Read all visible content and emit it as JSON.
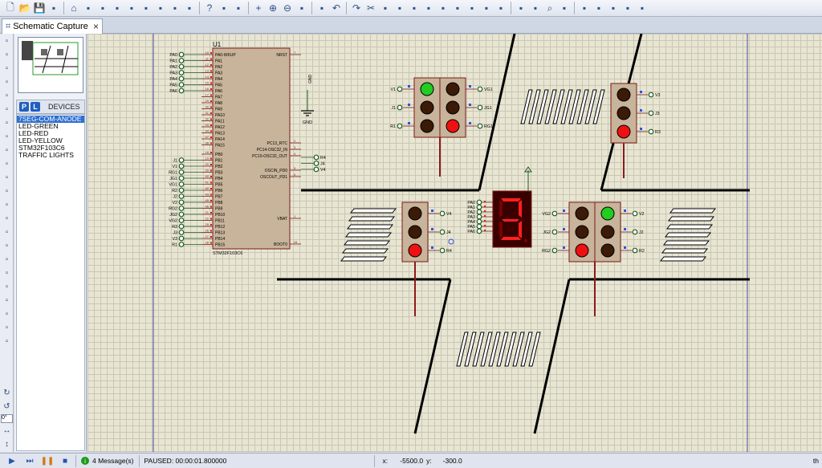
{
  "toolbar": {
    "icons": [
      "new-file-icon",
      "open-folder-icon",
      "save-icon",
      "import-icon",
      "home-icon",
      "grid-icon",
      "origin-icon",
      "pin-icon",
      "back-icon",
      "component-icon",
      "pdf-icon",
      "page-icon",
      "layout-icon",
      "help-icon",
      "refresh-icon",
      "grid-toggle-icon",
      "cross-icon",
      "zoom-in-icon",
      "zoom-out-icon",
      "zoom-fit-icon",
      "zoom-area-icon",
      "undo-icon",
      "redo-icon",
      "cut-icon",
      "copy-icon",
      "paste-icon",
      "block-copy-icon",
      "block-move-icon",
      "block-rotate-icon",
      "block-delete-icon",
      "pick-icon",
      "make-device-icon",
      "package-icon",
      "decompose-icon",
      "wire-autorouter-icon",
      "search-icon",
      "property-tool-icon",
      "new-sheet-icon",
      "remove-sheet-icon",
      "netlist-icon",
      "bom-icon",
      "erc-icon"
    ]
  },
  "tab": {
    "label": "Schematic Capture",
    "close": "×"
  },
  "devices": {
    "p": "P",
    "l": "L",
    "header": "DEVICES",
    "items": [
      "7SEG-COM-ANODE",
      "LED-GREEN",
      "LED-RED",
      "LED-YELLOW",
      "STM32F103C6",
      "TRAFFIC LIGHTS"
    ],
    "selected_index": 0
  },
  "rotation": {
    "value": "0°"
  },
  "status": {
    "messages": "4 Message(s)",
    "sim": "PAUSED: 00:00:01.800000",
    "x_label": "x:",
    "x_value": "-5500.0",
    "y_label": "y:",
    "y_value": "-300.0",
    "tail": "th"
  },
  "schematic": {
    "mcu": {
      "ref": "U1",
      "part": "STM32F103C6",
      "left_pins": [
        "PA0-WKUP",
        "PA1",
        "PA2",
        "PA3",
        "PA4",
        "PA5",
        "PA6",
        "PA7",
        "PA8",
        "PA9",
        "PA10",
        "PA11",
        "PA12",
        "PA13",
        "PA14",
        "PA15",
        "PB0",
        "PB1",
        "PB2",
        "PB3",
        "PB4",
        "PB5",
        "PB6",
        "PB7",
        "PB8",
        "PB9",
        "PB10",
        "PB11",
        "PB12",
        "PB13",
        "PB14",
        "PB15"
      ],
      "left_nums": [
        "10",
        "11",
        "12",
        "13",
        "14",
        "15",
        "16",
        "17",
        "29",
        "30",
        "31",
        "32",
        "33",
        "34",
        "37",
        "38",
        "18",
        "19",
        "20",
        "39",
        "40",
        "41",
        "42",
        "43",
        "45",
        "46",
        "21",
        "22",
        "25",
        "26",
        "27",
        "28"
      ],
      "right_pins": [
        "NRST",
        "PC13_RTC",
        "PC14-OSC32_IN",
        "PC15-OSC32_OUT",
        "OSCIN_PD0",
        "OSCOUT_PD1",
        "VBAT",
        "BOOT0"
      ],
      "right_nums": [
        "7",
        "2",
        "3",
        "4",
        "5",
        "6",
        "1",
        "44"
      ],
      "pa_labels": [
        "PA0",
        "PA1",
        "PA2",
        "PA3",
        "PA4",
        "PA5",
        "PA6"
      ],
      "pb_labels": [
        "J1",
        "V1",
        "RG1",
        "JG1",
        "VG1",
        "R2",
        "J2",
        "V2",
        "RG2",
        "JG2",
        "VG2",
        "R3",
        "J3",
        "V3",
        "R1"
      ],
      "pc_labels": [
        "R4",
        "J4",
        "V4"
      ]
    },
    "gnd": {
      "label": "GND"
    },
    "tl_top_left": {
      "left": [
        "V1",
        "J1",
        "R1"
      ],
      "right": [
        "VG1",
        "JG1",
        "RG1"
      ]
    },
    "tl_top_right": {
      "right": [
        "V3",
        "J3",
        "R3"
      ]
    },
    "tl_mid_left": {
      "right": [
        "V4",
        "J4",
        "R4"
      ]
    },
    "tl_mid_right": {
      "left": [
        "VG2",
        "JG2",
        "RG2"
      ],
      "right": [
        "V2",
        "J2",
        "R2"
      ]
    },
    "seg": {
      "digit": "3",
      "labels": [
        "PA0",
        "PA1",
        "PA2",
        "PA3",
        "PA4",
        "PA5",
        "PA6"
      ]
    }
  },
  "colors": {
    "wire": "#8b1a1a",
    "green_on": "#22cc22",
    "red_on": "#ee1111",
    "led_off": "#3b1a08",
    "seg_on": "#ff2020",
    "seg_bg": "#7a0000"
  }
}
